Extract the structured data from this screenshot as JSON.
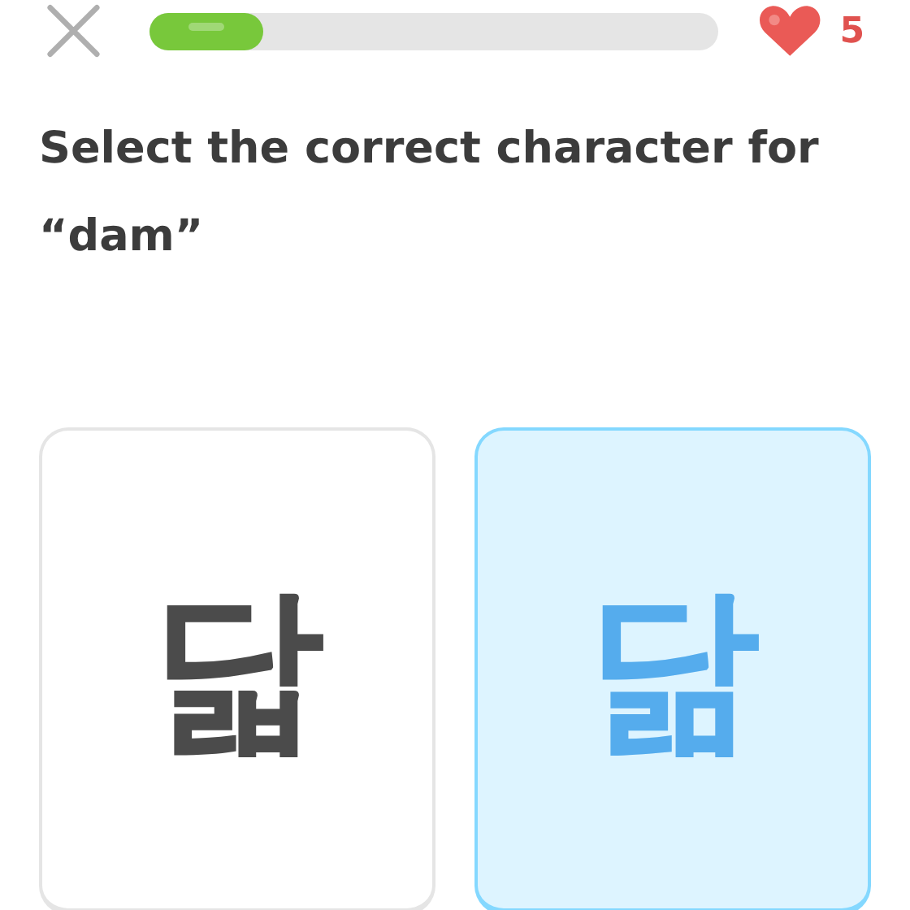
{
  "progress": {
    "level": 0.2
  },
  "hearts": {
    "count": "5"
  },
  "prompt": "Select the correct character for “dam”",
  "choices": [
    {
      "character": "닯",
      "selected": false
    },
    {
      "character": "닮",
      "selected": true
    }
  ]
}
